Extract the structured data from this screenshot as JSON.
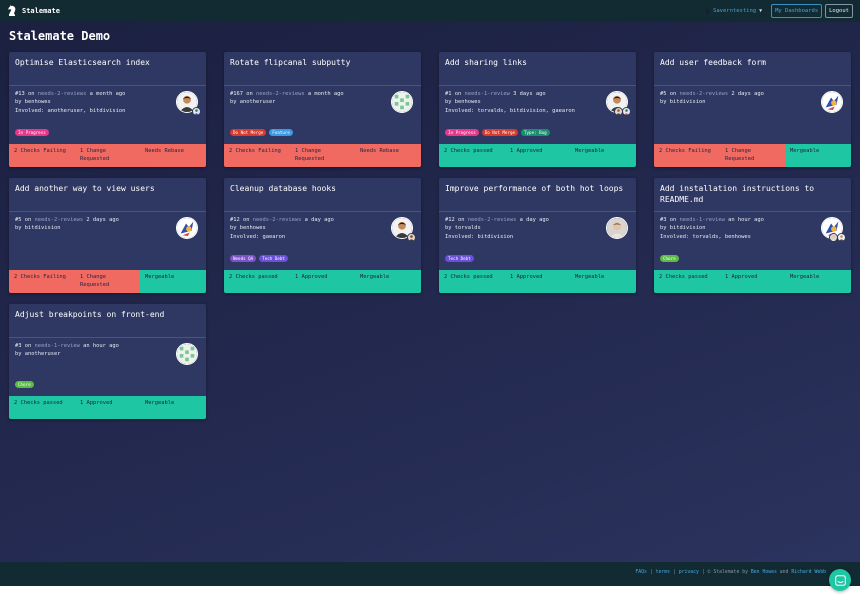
{
  "app": {
    "brand": "Stalemate"
  },
  "nav": {
    "user": "Saverntesting",
    "dashboards_label": "My Dashboards",
    "logout_label": "Logout"
  },
  "page": {
    "title": "Stalemate Demo"
  },
  "colors": {
    "fail": "#f16a62",
    "pass": "#1fc6a3",
    "card": "#2f3862",
    "navbar": "#122a31"
  },
  "cards": [
    {
      "title": "Optimise Elasticsearch index",
      "number": "#13",
      "on_text": " on ",
      "stage": "needs-2-reviews",
      "age": " a month ago",
      "by": "by benhowes",
      "involved": "Involved: anotheruser, bitdivision",
      "labels": [
        {
          "text": "In Progress",
          "color": "#e8378a"
        }
      ],
      "segments": [
        {
          "text": "2 Checks Failing",
          "status": "fail"
        },
        {
          "text": "1 Change Requested",
          "status": "fail"
        },
        {
          "text": "Needs Rebase",
          "status": "fail"
        }
      ]
    },
    {
      "title": "Rotate flipcanal subputty",
      "number": "#167",
      "on_text": " on ",
      "stage": "needs-2-reviews",
      "age": " a month ago",
      "by": "by anotheruser",
      "involved": "",
      "labels": [
        {
          "text": "Do Not Merge",
          "color": "#d73a2e"
        },
        {
          "text": "Feature",
          "color": "#3b9ae1"
        }
      ],
      "segments": [
        {
          "text": "2 Checks Failing",
          "status": "fail"
        },
        {
          "text": "1 Change Requested",
          "status": "fail"
        },
        {
          "text": "Needs Rebase",
          "status": "fail"
        }
      ]
    },
    {
      "title": "Add sharing links",
      "number": "#1",
      "on_text": " on ",
      "stage": "needs-1-review",
      "age": " 3 days ago",
      "by": "by benhowes",
      "involved": "Involved: torvalds, bitdivision, gaearon",
      "labels": [
        {
          "text": "In Progress",
          "color": "#e8378a"
        },
        {
          "text": "Do Not Merge",
          "color": "#d73a2e"
        },
        {
          "text": "Type: Bug",
          "color": "#1a8f6e"
        }
      ],
      "segments": [
        {
          "text": "2 Checks passed",
          "status": "pass"
        },
        {
          "text": "1 Approved",
          "status": "pass"
        },
        {
          "text": "Mergeable",
          "status": "pass"
        }
      ]
    },
    {
      "title": "Add user feedback form",
      "number": "#5",
      "on_text": " on ",
      "stage": "needs-2-reviews",
      "age": " 2 days ago",
      "by": "by bitdivision",
      "involved": "",
      "labels": [],
      "segments": [
        {
          "text": "2 Checks Failing",
          "status": "fail"
        },
        {
          "text": "1 Change Requested",
          "status": "fail"
        },
        {
          "text": "Mergeable",
          "status": "pass"
        }
      ]
    },
    {
      "title": "Add another way to view users",
      "number": "#5",
      "on_text": " on ",
      "stage": "needs-2-reviews",
      "age": " 2 days ago",
      "by": "by bitdivision",
      "involved": "",
      "labels": [],
      "segments": [
        {
          "text": "2 Checks Failing",
          "status": "fail"
        },
        {
          "text": "1 Change Requested",
          "status": "fail"
        },
        {
          "text": "Mergeable",
          "status": "pass"
        }
      ]
    },
    {
      "title": "Cleanup database hooks",
      "number": "#12",
      "on_text": " on ",
      "stage": "needs-2-reviews",
      "age": " a day ago",
      "by": "by benhowes",
      "involved": "Involved: gaearon",
      "labels": [
        {
          "text": "Needs QA",
          "color": "#7d52c9"
        },
        {
          "text": "Tech Debt",
          "color": "#6a4fd8"
        }
      ],
      "segments": [
        {
          "text": "2 Checks passed",
          "status": "pass"
        },
        {
          "text": "1 Approved",
          "status": "pass"
        },
        {
          "text": "Mergeable",
          "status": "pass"
        }
      ]
    },
    {
      "title": "Improve performance of both hot loops",
      "number": "#12",
      "on_text": " on ",
      "stage": "needs-2-reviews",
      "age": " a day ago",
      "by": "by torvalds",
      "involved": "Involved: bitdivision",
      "labels": [
        {
          "text": "Tech Debt",
          "color": "#6a4fd8"
        }
      ],
      "segments": [
        {
          "text": "2 Checks passed",
          "status": "pass"
        },
        {
          "text": "1 Approved",
          "status": "pass"
        },
        {
          "text": "Mergeable",
          "status": "pass"
        }
      ]
    },
    {
      "title": "Add installation instructions to README.md",
      "number": "#3",
      "on_text": " on ",
      "stage": "needs-1-review",
      "age": " an hour ago",
      "by": "by bitdivision",
      "involved": "Involved: torvalds, benhowes",
      "labels": [
        {
          "text": "Chore",
          "color": "#5cba47"
        }
      ],
      "segments": [
        {
          "text": "2 Checks passed",
          "status": "pass"
        },
        {
          "text": "1 Approved",
          "status": "pass"
        },
        {
          "text": "Mergeable",
          "status": "pass"
        }
      ]
    },
    {
      "title": "Adjust breakpoints on front-end",
      "number": "#3",
      "on_text": " on ",
      "stage": "needs-1-review",
      "age": " an hour ago",
      "by": "by anotheruser",
      "involved": "",
      "labels": [
        {
          "text": "Chore",
          "color": "#5cba47"
        }
      ],
      "segments": [
        {
          "text": "2 Checks passed",
          "status": "pass"
        },
        {
          "text": "1 Approved",
          "status": "pass"
        },
        {
          "text": "Mergeable",
          "status": "pass"
        }
      ]
    }
  ],
  "footer": {
    "faqs": "FAQs",
    "sep1": " | ",
    "terms": "terms",
    "sep2": " | ",
    "privacy": "privacy",
    "made_by": " | © Stalemate by ",
    "author1": "Ben Howes",
    "and": " and ",
    "author2": "Richard Webb"
  }
}
